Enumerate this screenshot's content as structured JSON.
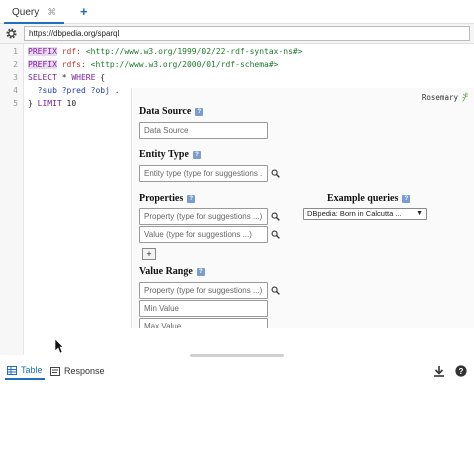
{
  "tab": {
    "label": "Query",
    "close": "⌘",
    "add": "+"
  },
  "endpoint": {
    "value": "https://dbpedia.org/sparql"
  },
  "editor": {
    "line_numbers": [
      "1",
      "2",
      "3",
      "4",
      "5"
    ],
    "lines": [
      [
        {
          "t": "PREFIX",
          "c": "pfx"
        },
        {
          "t": " ",
          "c": ""
        },
        {
          "t": "rdf:",
          "c": "ns"
        },
        {
          "t": " <http://www.w3.org/1999/02/22-rdf-syntax-ns#>",
          "c": "uri"
        }
      ],
      [
        {
          "t": "PREFIX",
          "c": "pfx"
        },
        {
          "t": " ",
          "c": ""
        },
        {
          "t": "rdfs:",
          "c": "ns"
        },
        {
          "t": " <http://www.w3.org/2000/01/rdf-schema#>",
          "c": "uri"
        }
      ],
      [
        {
          "t": "SELECT",
          "c": "kw"
        },
        {
          "t": " * ",
          "c": ""
        },
        {
          "t": "WHERE",
          "c": "kw"
        },
        {
          "t": " {",
          "c": ""
        }
      ],
      [
        {
          "t": "  ",
          "c": ""
        },
        {
          "t": "?sub ?pred ?obj",
          "c": "var"
        },
        {
          "t": " .",
          "c": ""
        }
      ],
      [
        {
          "t": "} ",
          "c": ""
        },
        {
          "t": "LIMIT",
          "c": "kw"
        },
        {
          "t": " 10",
          "c": ""
        }
      ]
    ]
  },
  "rosemary": {
    "brand": "Rosemary",
    "data_source": {
      "title": "Data Source",
      "placeholder": "Data Source"
    },
    "entity_type": {
      "title": "Entity Type",
      "placeholder": "Entity type (type for suggestions ..."
    },
    "properties": {
      "title": "Properties",
      "property_placeholder": "Property (type for suggestions ...)",
      "value_placeholder": "Value (type for suggestions ...)",
      "add": "+"
    },
    "example_queries": {
      "title": "Example queries",
      "selected": "DBpedia: Born in Calcutta ..."
    },
    "value_range": {
      "title": "Value Range",
      "property_placeholder": "Property (type for suggestions ...)",
      "min_placeholder": "Min Value",
      "max_placeholder": "Max Value"
    },
    "info": "?"
  },
  "results": {
    "tabs": [
      {
        "label": "Table",
        "active": true
      },
      {
        "label": "Response",
        "active": false
      }
    ]
  },
  "colors": {
    "accent": "#1f6fbd",
    "keyword": "#7a1fa2",
    "uri": "#1d7a2d",
    "prefix_ns": "#c0392b",
    "variable": "#1f3aa8"
  },
  "icons": [
    "gear-icon",
    "share-icon",
    "play-icon",
    "rosemary-leaf-icon",
    "info-icon",
    "search-icon",
    "download-icon",
    "help-icon",
    "table-icon",
    "response-icon"
  ]
}
